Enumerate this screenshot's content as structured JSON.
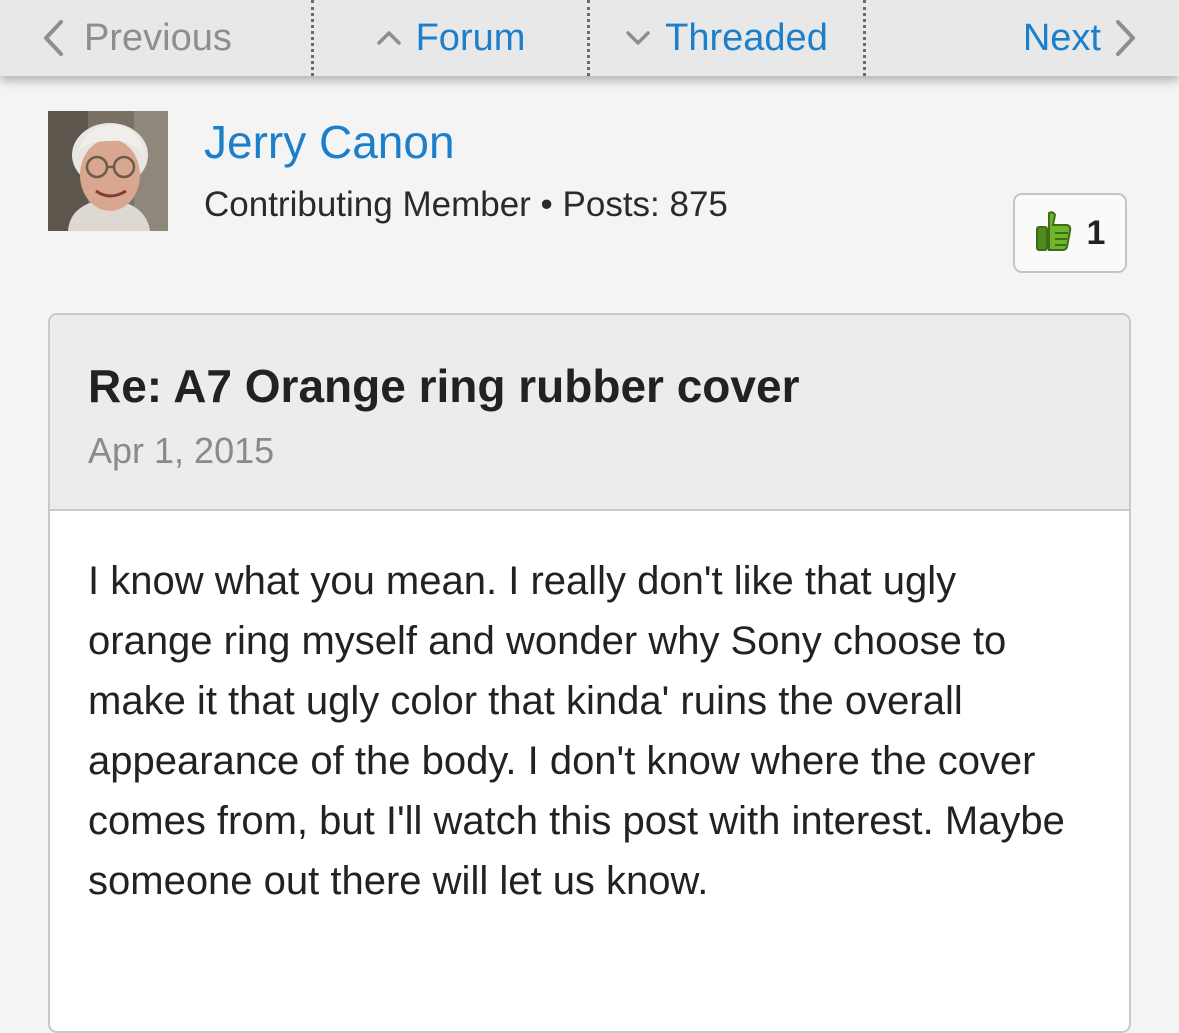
{
  "nav": {
    "previous_label": "Previous",
    "forum_label": "Forum",
    "threaded_label": "Threaded",
    "next_label": "Next"
  },
  "author": {
    "name": "Jerry Canon",
    "meta": "Contributing Member • Posts: 875"
  },
  "like": {
    "count": "1",
    "icon": "thumbs-up-icon"
  },
  "post": {
    "title": "Re: A7 Orange ring rubber cover",
    "date": "Apr 1, 2015",
    "body": "I know what you mean. I really don't like that ugly orange ring myself and wonder why Sony choose to make it that ugly color that kinda' ruins the overall appearance of the body. I don't know where the cover comes from, but I'll watch this post with interest. Maybe someone out there will let us know."
  },
  "colors": {
    "link": "#1c7fcb",
    "disabled": "#8e8e8e",
    "like_green": "#6fb52c"
  }
}
